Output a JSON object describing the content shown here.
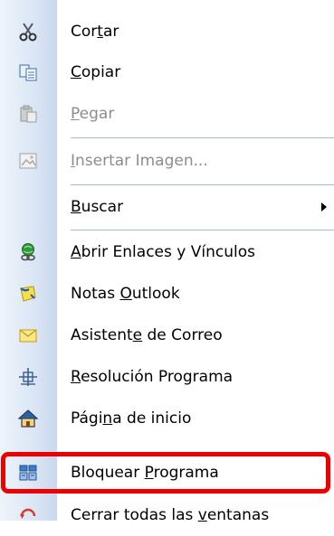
{
  "menu": {
    "items": [
      {
        "pre": "Cor",
        "ul": "t",
        "post": "ar",
        "icon": "scissors-icon",
        "disabled": false
      },
      {
        "pre": "",
        "ul": "C",
        "post": "opiar",
        "icon": "copy-icon",
        "disabled": false
      },
      {
        "pre": "",
        "ul": "P",
        "post": "egar",
        "icon": "paste-icon",
        "disabled": true
      },
      {
        "pre": "",
        "ul": "I",
        "post": "nsertar Imagen...",
        "icon": "image-icon",
        "disabled": true
      },
      {
        "pre": "",
        "ul": "B",
        "post": "uscar",
        "icon": "",
        "disabled": false,
        "submenu": true
      },
      {
        "pre": "",
        "ul": "A",
        "post": "brir Enlaces y Vínculos",
        "icon": "links-icon",
        "disabled": false
      },
      {
        "pre": "Notas ",
        "ul": "O",
        "post": "utlook",
        "icon": "notes-icon",
        "disabled": false
      },
      {
        "pre": "Asistent",
        "ul": "e",
        "post": " de Correo",
        "icon": "envelope-icon",
        "disabled": false
      },
      {
        "pre": "",
        "ul": "R",
        "post": "esolución Programa",
        "icon": "resolution-icon",
        "disabled": false
      },
      {
        "pre": "Pági",
        "ul": "n",
        "post": "a de inicio",
        "icon": "home-icon",
        "disabled": false
      },
      {
        "pre": "Bloquear ",
        "ul": "P",
        "post": "rograma",
        "icon": "lock-program-icon",
        "disabled": false
      },
      {
        "pre": "Cerrar todas las ",
        "ul": "v",
        "post": "entanas",
        "icon": "close-windows-icon",
        "disabled": false
      }
    ],
    "highlight_color": "#ee0000",
    "gutter_color": "#dbe6f5"
  }
}
